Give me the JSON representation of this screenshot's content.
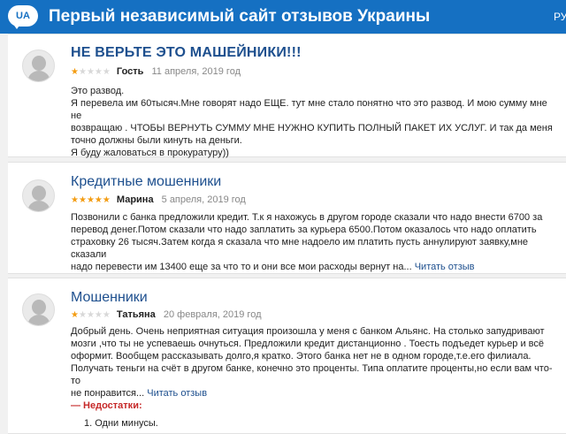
{
  "header": {
    "logo_text": "UA",
    "title": "Первый независимый сайт отзывов Украины",
    "lang": "РУ"
  },
  "reviews": [
    {
      "title": "НЕ ВЕРЬТЕ ЭТО МАШЕЙНИКИ!!!",
      "rating": 1,
      "author": "Гость",
      "date": "11 апреля, 2019 год",
      "lines": [
        "Это развод.",
        "Я перевела им 60тысяч.Мне говорят надо ЕЩЕ. тут мне стало понятно что это развод. И мою сумму мне не",
        "возвращаю . ЧТОБЫ ВЕРНУТЬ СУММУ МНЕ НУЖНО КУПИТЬ ПОЛНЫЙ ПАКЕТ ИХ УСЛУГ. И так да меня",
        "точно должны были кинуть на деньги.",
        "Я буду жаловаться в прокуратуру))"
      ]
    },
    {
      "title": "Кредитные мошенники",
      "rating": 5,
      "author": "Марина",
      "date": "5 апреля, 2019 год",
      "lines": [
        "Позвонили с банка предложили кредит. Т.к я нахожусь в другом городе сказали что надо внести 6700 за",
        "перевод денег.Потом сказали что надо заплатить за курьера 6500.Потом оказалось что надо оплатить",
        "страховку 26 тысяч.Затем когда я сказала что мне надоело им платить пусть аннулируют заявку,мне сказали",
        "надо перевести им 13400 еще за что то и они все мои расходы вернут на..."
      ],
      "read_more": "Читать отзыв"
    },
    {
      "title": "Мошенники",
      "rating": 1,
      "author": "Татьяна",
      "date": "20 февраля, 2019 год",
      "lines": [
        "Добрый день.  Очень неприятная ситуация произошла у меня с банком Альянс. На столько запудривают",
        "мозги ,что ты не успеваешь очнуться. Предложили кредит дистанционно . Тоесть подъедет курьер и всё",
        "оформит. Вообщем рассказывать долго,я кратко. Этого банка нет не в одном городе,т.е.его филиала.",
        "Получать теньги на счёт в другом банке, конечно это проценты. Типа оплатите проценты,но если вам что-то",
        "не понравится..."
      ],
      "read_more": "Читать отзыв",
      "cons_label": "— Недостатки:",
      "cons": [
        "1.  Одни минусы."
      ]
    }
  ],
  "colors": {
    "header_bg": "#1570c2",
    "title_blue": "#1d4f8e",
    "star_on": "#f39c12",
    "cons_red": "#c62828"
  }
}
